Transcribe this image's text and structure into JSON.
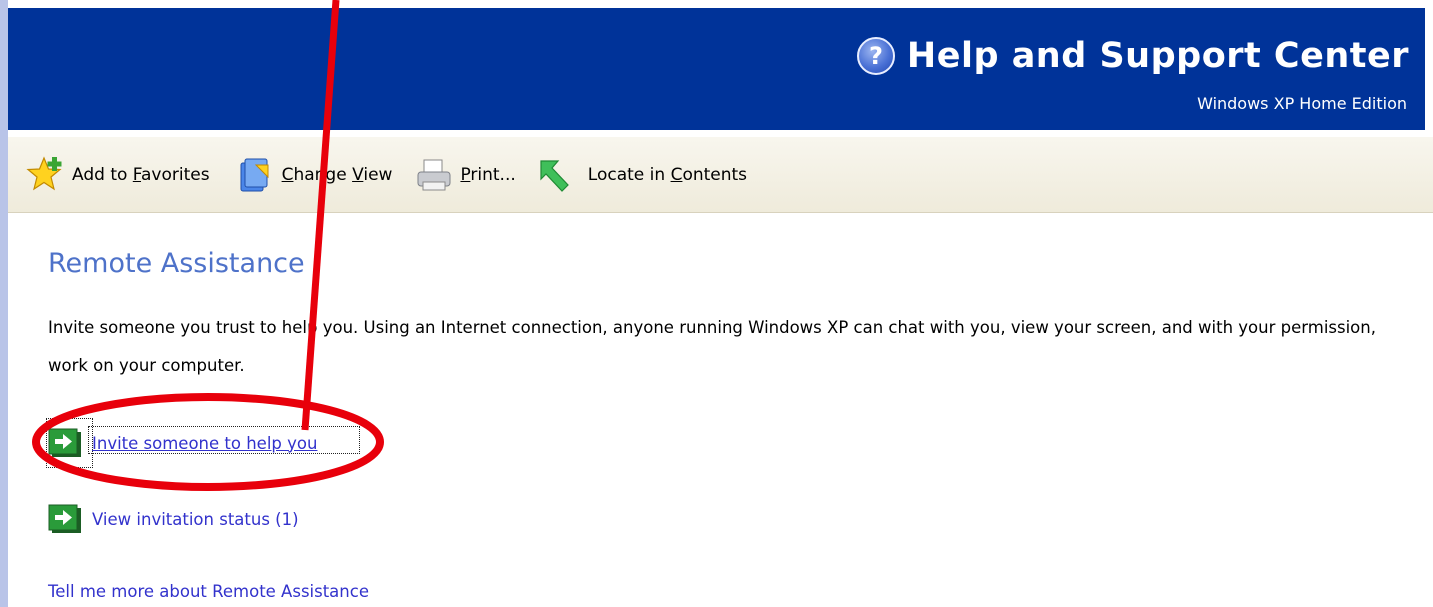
{
  "header": {
    "title": "Help and Support Center",
    "subtitle": "Windows XP Home Edition",
    "icon": "help-icon",
    "color": "#003399"
  },
  "toolbar": {
    "items": [
      {
        "label_before": "Add to ",
        "mnemonic": "F",
        "label_after": "avorites",
        "icon": "favorites-star-icon"
      },
      {
        "label_before": "",
        "mnemonic": "C",
        "label_after": "hange View",
        "icon": "change-view-icon"
      },
      {
        "label_before": "",
        "mnemonic": "P",
        "label_after": "rint...",
        "icon": "printer-icon"
      },
      {
        "label_before": "Locate in ",
        "mnemonic": "C",
        "label_after": "ontents",
        "icon": "locate-arrow-icon"
      }
    ],
    "change_view_extra": "V"
  },
  "main": {
    "title": "Remote Assistance",
    "intro": "Invite someone you trust to help you. Using an Internet connection, anyone running Windows XP can chat with you, view your screen, and with your permission, work on your computer.",
    "tasks": [
      {
        "label": "Invite someone to help you",
        "icon": "green-arrow-icon"
      },
      {
        "label": "View invitation status (1)",
        "icon": "green-arrow-icon"
      }
    ],
    "more_link": "Tell me more about Remote Assistance"
  },
  "annotation": {
    "color": "#e8000b",
    "shapes": [
      "arrow-line",
      "ellipse-highlight"
    ]
  }
}
